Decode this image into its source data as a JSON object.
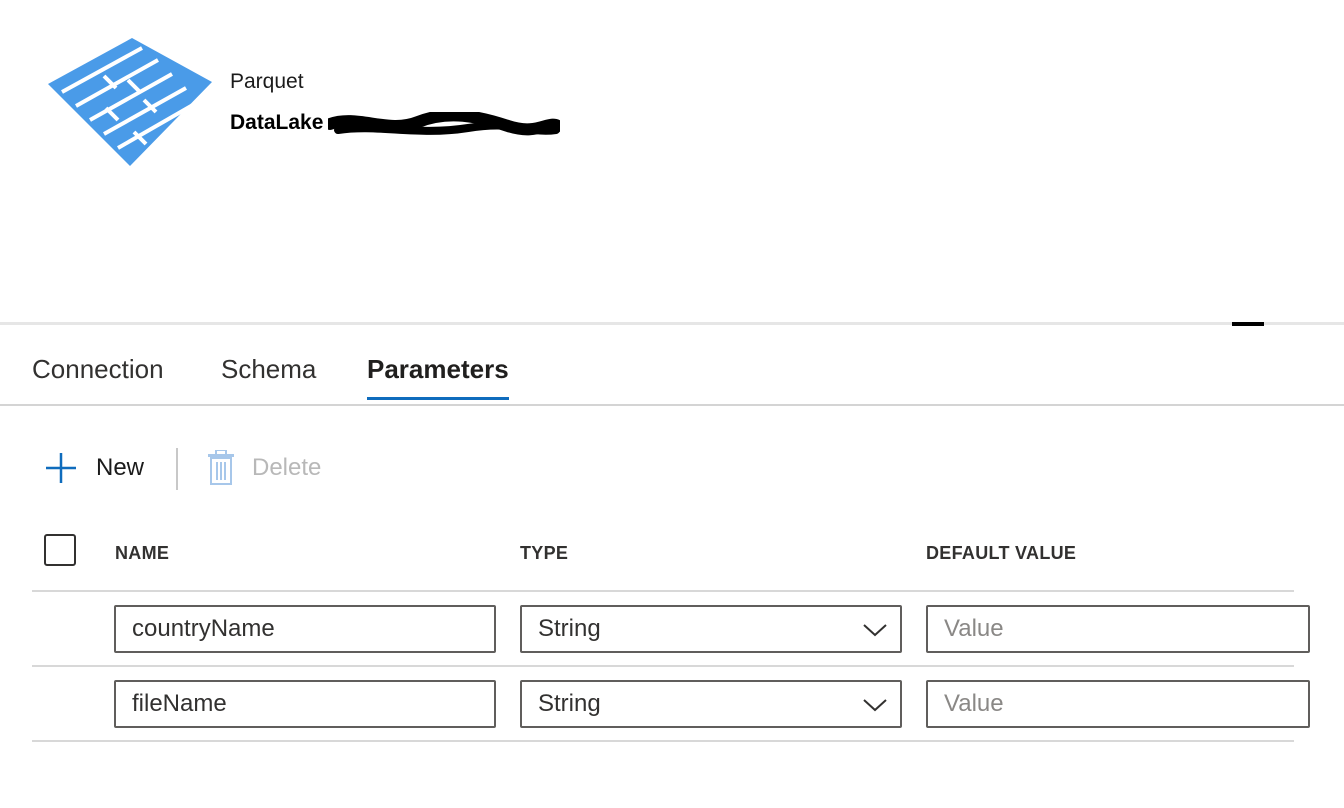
{
  "dataset": {
    "type": "Parquet",
    "name": "DataLake"
  },
  "tabs": [
    {
      "label": "Connection"
    },
    {
      "label": "Schema"
    },
    {
      "label": "Parameters",
      "active": true
    }
  ],
  "toolbar": {
    "new_label": "New",
    "delete_label": "Delete"
  },
  "table": {
    "columns": [
      "NAME",
      "TYPE",
      "DEFAULT VALUE"
    ],
    "rows": [
      {
        "name": "countryName",
        "type": "String",
        "default_placeholder": "Value"
      },
      {
        "name": "fileName",
        "type": "String",
        "default_placeholder": "Value"
      }
    ]
  },
  "colors": {
    "logo_blue": "#4a9be8",
    "tab_underline": "#0f6cbd",
    "new_icon": "#0f6cbd",
    "delete_disabled": "#a7c7ea"
  }
}
